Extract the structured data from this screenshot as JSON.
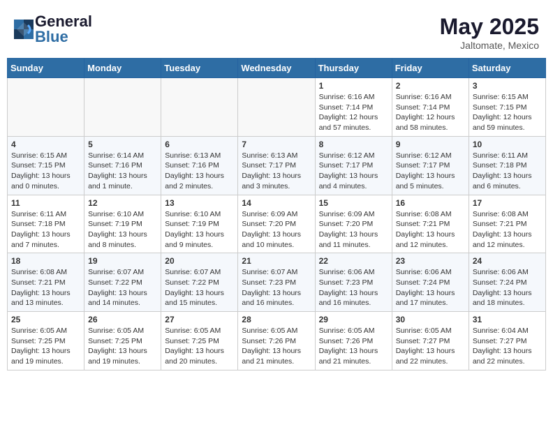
{
  "header": {
    "logo_general": "General",
    "logo_blue": "Blue",
    "month": "May 2025",
    "location": "Jaltomate, Mexico"
  },
  "weekdays": [
    "Sunday",
    "Monday",
    "Tuesday",
    "Wednesday",
    "Thursday",
    "Friday",
    "Saturday"
  ],
  "weeks": [
    [
      {
        "day": "",
        "info": ""
      },
      {
        "day": "",
        "info": ""
      },
      {
        "day": "",
        "info": ""
      },
      {
        "day": "",
        "info": ""
      },
      {
        "day": "1",
        "info": "Sunrise: 6:16 AM\nSunset: 7:14 PM\nDaylight: 12 hours\nand 57 minutes."
      },
      {
        "day": "2",
        "info": "Sunrise: 6:16 AM\nSunset: 7:14 PM\nDaylight: 12 hours\nand 58 minutes."
      },
      {
        "day": "3",
        "info": "Sunrise: 6:15 AM\nSunset: 7:15 PM\nDaylight: 12 hours\nand 59 minutes."
      }
    ],
    [
      {
        "day": "4",
        "info": "Sunrise: 6:15 AM\nSunset: 7:15 PM\nDaylight: 13 hours\nand 0 minutes."
      },
      {
        "day": "5",
        "info": "Sunrise: 6:14 AM\nSunset: 7:16 PM\nDaylight: 13 hours\nand 1 minute."
      },
      {
        "day": "6",
        "info": "Sunrise: 6:13 AM\nSunset: 7:16 PM\nDaylight: 13 hours\nand 2 minutes."
      },
      {
        "day": "7",
        "info": "Sunrise: 6:13 AM\nSunset: 7:17 PM\nDaylight: 13 hours\nand 3 minutes."
      },
      {
        "day": "8",
        "info": "Sunrise: 6:12 AM\nSunset: 7:17 PM\nDaylight: 13 hours\nand 4 minutes."
      },
      {
        "day": "9",
        "info": "Sunrise: 6:12 AM\nSunset: 7:17 PM\nDaylight: 13 hours\nand 5 minutes."
      },
      {
        "day": "10",
        "info": "Sunrise: 6:11 AM\nSunset: 7:18 PM\nDaylight: 13 hours\nand 6 minutes."
      }
    ],
    [
      {
        "day": "11",
        "info": "Sunrise: 6:11 AM\nSunset: 7:18 PM\nDaylight: 13 hours\nand 7 minutes."
      },
      {
        "day": "12",
        "info": "Sunrise: 6:10 AM\nSunset: 7:19 PM\nDaylight: 13 hours\nand 8 minutes."
      },
      {
        "day": "13",
        "info": "Sunrise: 6:10 AM\nSunset: 7:19 PM\nDaylight: 13 hours\nand 9 minutes."
      },
      {
        "day": "14",
        "info": "Sunrise: 6:09 AM\nSunset: 7:20 PM\nDaylight: 13 hours\nand 10 minutes."
      },
      {
        "day": "15",
        "info": "Sunrise: 6:09 AM\nSunset: 7:20 PM\nDaylight: 13 hours\nand 11 minutes."
      },
      {
        "day": "16",
        "info": "Sunrise: 6:08 AM\nSunset: 7:21 PM\nDaylight: 13 hours\nand 12 minutes."
      },
      {
        "day": "17",
        "info": "Sunrise: 6:08 AM\nSunset: 7:21 PM\nDaylight: 13 hours\nand 12 minutes."
      }
    ],
    [
      {
        "day": "18",
        "info": "Sunrise: 6:08 AM\nSunset: 7:21 PM\nDaylight: 13 hours\nand 13 minutes."
      },
      {
        "day": "19",
        "info": "Sunrise: 6:07 AM\nSunset: 7:22 PM\nDaylight: 13 hours\nand 14 minutes."
      },
      {
        "day": "20",
        "info": "Sunrise: 6:07 AM\nSunset: 7:22 PM\nDaylight: 13 hours\nand 15 minutes."
      },
      {
        "day": "21",
        "info": "Sunrise: 6:07 AM\nSunset: 7:23 PM\nDaylight: 13 hours\nand 16 minutes."
      },
      {
        "day": "22",
        "info": "Sunrise: 6:06 AM\nSunset: 7:23 PM\nDaylight: 13 hours\nand 16 minutes."
      },
      {
        "day": "23",
        "info": "Sunrise: 6:06 AM\nSunset: 7:24 PM\nDaylight: 13 hours\nand 17 minutes."
      },
      {
        "day": "24",
        "info": "Sunrise: 6:06 AM\nSunset: 7:24 PM\nDaylight: 13 hours\nand 18 minutes."
      }
    ],
    [
      {
        "day": "25",
        "info": "Sunrise: 6:05 AM\nSunset: 7:25 PM\nDaylight: 13 hours\nand 19 minutes."
      },
      {
        "day": "26",
        "info": "Sunrise: 6:05 AM\nSunset: 7:25 PM\nDaylight: 13 hours\nand 19 minutes."
      },
      {
        "day": "27",
        "info": "Sunrise: 6:05 AM\nSunset: 7:25 PM\nDaylight: 13 hours\nand 20 minutes."
      },
      {
        "day": "28",
        "info": "Sunrise: 6:05 AM\nSunset: 7:26 PM\nDaylight: 13 hours\nand 21 minutes."
      },
      {
        "day": "29",
        "info": "Sunrise: 6:05 AM\nSunset: 7:26 PM\nDaylight: 13 hours\nand 21 minutes."
      },
      {
        "day": "30",
        "info": "Sunrise: 6:05 AM\nSunset: 7:27 PM\nDaylight: 13 hours\nand 22 minutes."
      },
      {
        "day": "31",
        "info": "Sunrise: 6:04 AM\nSunset: 7:27 PM\nDaylight: 13 hours\nand 22 minutes."
      }
    ]
  ]
}
